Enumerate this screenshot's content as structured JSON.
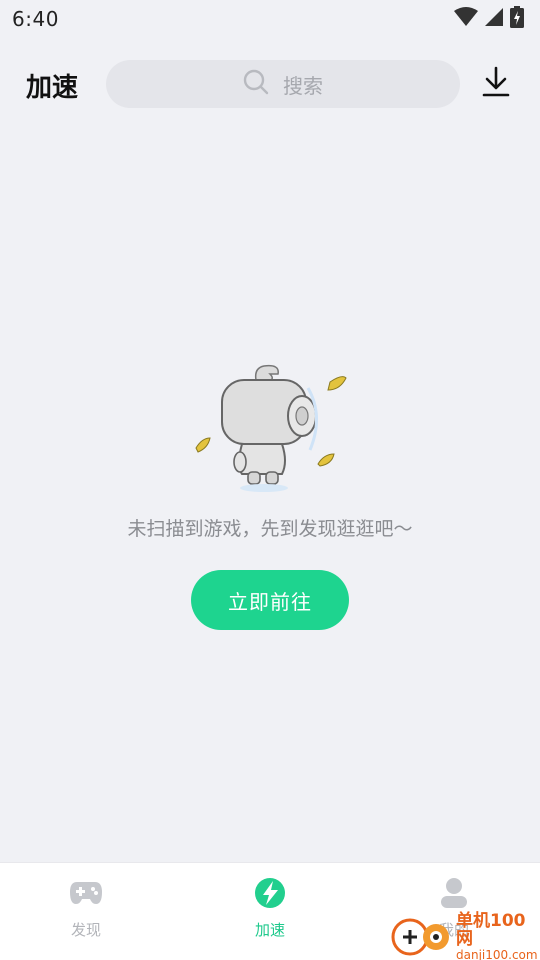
{
  "status_bar": {
    "time": "6:40",
    "icons": [
      "wifi-icon",
      "signal-icon",
      "battery-charging-icon"
    ]
  },
  "header": {
    "title": "加速",
    "search_placeholder": "搜索",
    "search_icon": "search-icon",
    "download_icon": "download-icon"
  },
  "empty_state": {
    "illustration": "robot-mascot-with-leaves",
    "message": "未扫描到游戏，先到发现逛逛吧～",
    "button_label": "立即前往"
  },
  "bottom_nav": {
    "items": [
      {
        "label": "发现",
        "icon": "gamepad-icon",
        "active": false
      },
      {
        "label": "加速",
        "icon": "speed-bolt-icon",
        "active": true
      },
      {
        "label": "我的",
        "icon": "user-icon",
        "active": false
      }
    ]
  },
  "watermark": {
    "title": "单机100网",
    "url": "danji100.com"
  },
  "colors": {
    "accent": "#1ed48f",
    "background": "#f0f1f5",
    "watermark": "#e8641c"
  }
}
